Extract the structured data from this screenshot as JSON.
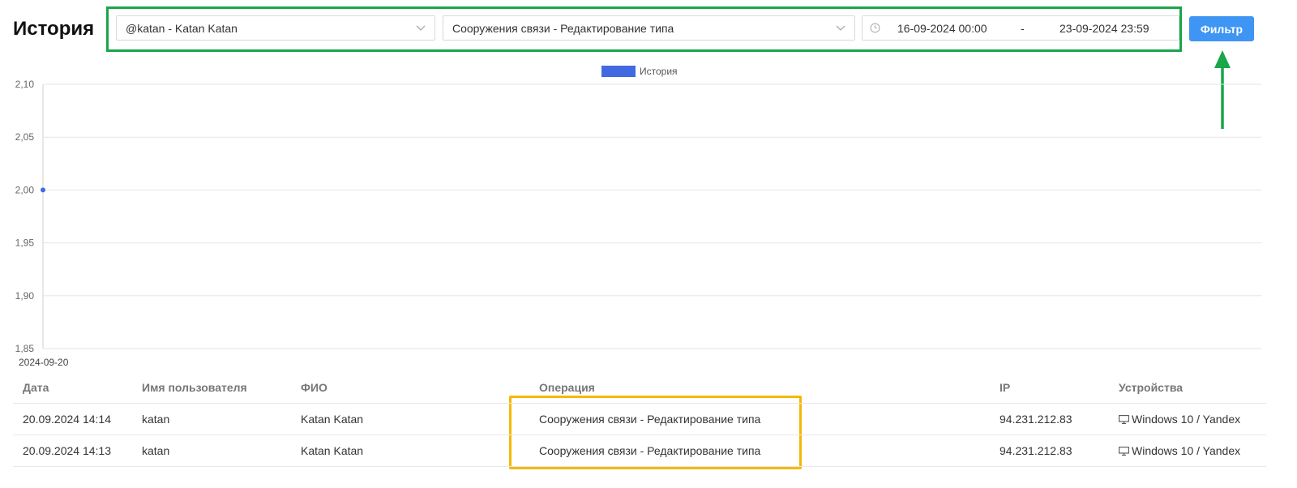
{
  "page": {
    "title": "История"
  },
  "filters": {
    "user_value": "@katan - Katan Katan",
    "operation_value": "Сооружения связи - Редактирование типа",
    "date_from": "16-09-2024 00:00",
    "date_separator": "-",
    "date_to": "23-09-2024 23:59",
    "filter_button": "Фильтр"
  },
  "colors": {
    "highlight_filters": "#1aa64a",
    "highlight_operations": "#f5b800",
    "series": "#4169e1",
    "button": "#3e95f3"
  },
  "chart_data": {
    "type": "line",
    "legend": "История",
    "legend_position": "top-center",
    "y_ticks": [
      "2,10",
      "2,05",
      "2,00",
      "1,95",
      "1,90",
      "1,85"
    ],
    "ylim": [
      1.85,
      2.1
    ],
    "x_ticks": [
      "2024-09-20"
    ],
    "points": [
      {
        "x": "2024-09-20",
        "y": 2
      }
    ],
    "grid": true
  },
  "table": {
    "columns": [
      "Дата",
      "Имя пользователя",
      "ФИО",
      "Операция",
      "IP",
      "Устройства"
    ],
    "rows": [
      [
        "20.09.2024 14:14",
        "katan",
        "Katan Katan",
        "Сооружения связи - Редактирование типа",
        "94.231.212.83",
        "Windows 10 / Yandex"
      ],
      [
        "20.09.2024 14:13",
        "katan",
        "Katan Katan",
        "Сооружения связи - Редактирование типа",
        "94.231.212.83",
        "Windows 10 / Yandex"
      ]
    ]
  }
}
